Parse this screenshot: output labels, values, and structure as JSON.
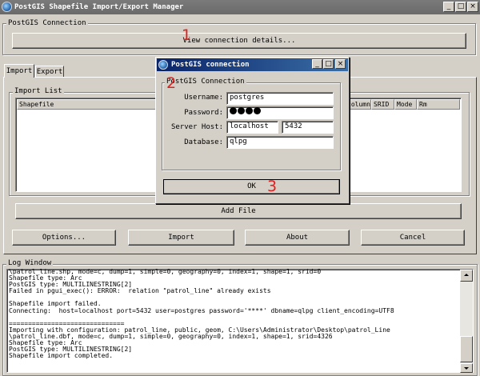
{
  "window": {
    "title": "PostGIS Shapefile Import/Export Manager"
  },
  "connection_group": {
    "label": "PostGIS Connection",
    "view_button": "View connection details..."
  },
  "tabs": [
    {
      "label": "Import"
    },
    {
      "label": "Export"
    }
  ],
  "import_list": {
    "label": "Import List",
    "columns": [
      "Shapefile",
      "column",
      "SRID",
      "Mode",
      "Rm"
    ],
    "add_file": "Add File"
  },
  "actions": {
    "options": "Options...",
    "import": "Import",
    "about": "About",
    "cancel": "Cancel"
  },
  "log": {
    "label": "Log Window",
    "lines": [
      "\\patrol_line.shp, mode=c, dump=1, simple=0, geography=0, index=1, shape=1, srid=0",
      "Shapefile type: Arc",
      "PostGIS type: MULTILINESTRING[2]",
      "Failed in pgui_exec(): ERROR:  relation \"patrol_line\" already exists",
      "",
      "Shapefile import failed.",
      "Connecting:  host=localhost port=5432 user=postgres password='****' dbname=qlpg client_encoding=UTF8",
      "",
      "==============================",
      "Importing with configuration: patrol_line, public, geom, C:\\Users\\Administrator\\Desktop\\patrol_Line",
      "\\patrol_line.dbf, mode=c, dump=1, simple=0, geography=0, index=1, shape=1, srid=4326",
      "Shapefile type: Arc",
      "PostGIS type: MULTILINESTRING[2]",
      "Shapefile import completed."
    ]
  },
  "dialog": {
    "title": "PostGIS connection",
    "group_label": "PostGIS Connection",
    "username_label": "Username:",
    "username": "postgres",
    "password_label": "Password:",
    "password_dots": 4,
    "host_label": "Server Host:",
    "host": "localhost",
    "port": "5432",
    "database_label": "Database:",
    "database": "qlpg",
    "ok": "OK"
  },
  "annotations": {
    "one": "1",
    "two": "2",
    "three": "3"
  }
}
